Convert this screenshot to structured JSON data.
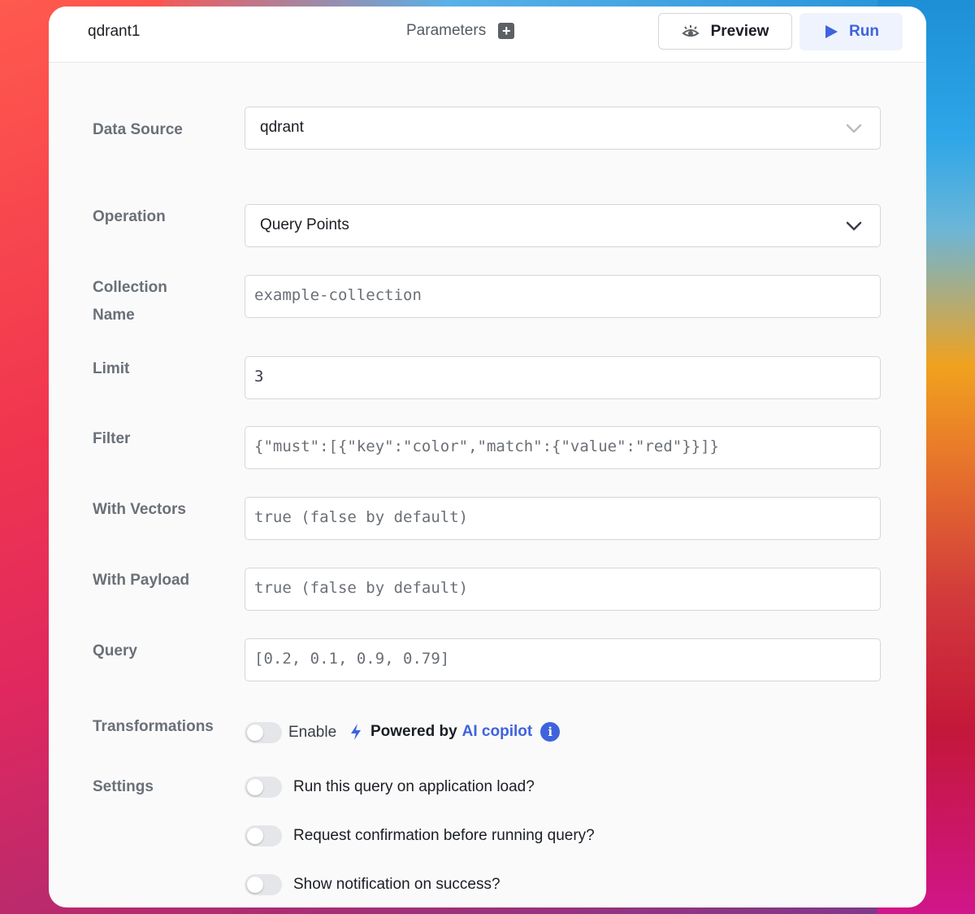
{
  "header": {
    "query_name": "qdrant1",
    "parameters_label": "Parameters",
    "preview_label": "Preview",
    "run_label": "Run"
  },
  "form": {
    "data_source": {
      "label": "Data Source",
      "value": "qdrant"
    },
    "operation": {
      "label": "Operation",
      "value": "Query Points"
    },
    "collection_name": {
      "label_line1": "Collection",
      "label_line2": "Name",
      "placeholder": "example-collection"
    },
    "limit": {
      "label": "Limit",
      "value": "3"
    },
    "filter": {
      "label": "Filter",
      "placeholder": "{\"must\":[{\"key\":\"color\",\"match\":{\"value\":\"red\"}}]}"
    },
    "with_vectors": {
      "label": "With Vectors",
      "placeholder": "true (false by default)"
    },
    "with_payload": {
      "label": "With Payload",
      "placeholder": "true (false by default)"
    },
    "query": {
      "label": "Query",
      "placeholder": "[0.2, 0.1, 0.9, 0.79]"
    },
    "transformations": {
      "label": "Transformations",
      "enable_label": "Enable",
      "enabled": false,
      "powered_by": "Powered by",
      "ai_copilot": "AI copilot"
    },
    "settings": {
      "label": "Settings",
      "toggles": [
        {
          "label": "Run this query on application load?",
          "enabled": false
        },
        {
          "label": "Request confirmation before running query?",
          "enabled": false
        },
        {
          "label": "Show notification on success?",
          "enabled": false
        }
      ]
    }
  },
  "colors": {
    "accent": "#3e63dd",
    "label": "#6a7078",
    "border": "#d3d6da"
  }
}
